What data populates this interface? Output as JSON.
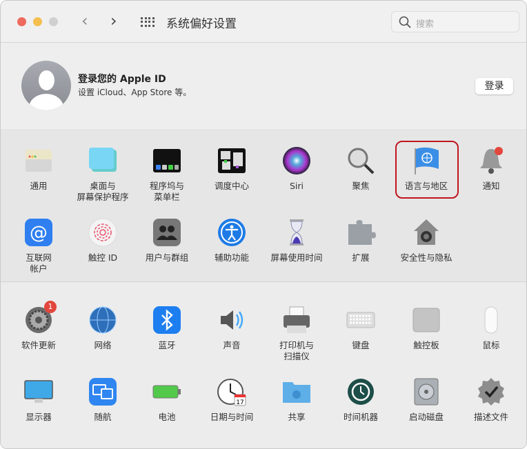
{
  "window": {
    "title": "系统偏好设置",
    "search_placeholder": "搜索"
  },
  "apple_id": {
    "title": "登录您的 Apple ID",
    "subtitle": "设置 iCloud、App Store 等。",
    "button": "登录"
  },
  "section1": [
    {
      "label": "通用",
      "icon": "general-icon"
    },
    {
      "label": "桌面与\n屏幕保护程序",
      "icon": "desktop-icon"
    },
    {
      "label": "程序坞与\n菜单栏",
      "icon": "dock-icon"
    },
    {
      "label": "调度中心",
      "icon": "mission-control-icon"
    },
    {
      "label": "Siri",
      "icon": "siri-icon"
    },
    {
      "label": "聚焦",
      "icon": "spotlight-icon"
    },
    {
      "label": "语言与地区",
      "icon": "language-flag-icon",
      "highlighted": true
    },
    {
      "label": "通知",
      "icon": "notification-bell-icon"
    },
    {
      "label": "互联网\n帐户",
      "icon": "internet-accounts-icon"
    },
    {
      "label": "触控 ID",
      "icon": "touch-id-icon"
    },
    {
      "label": "用户与群组",
      "icon": "users-groups-icon"
    },
    {
      "label": "辅助功能",
      "icon": "accessibility-icon"
    },
    {
      "label": "屏幕使用时间",
      "icon": "screen-time-icon"
    },
    {
      "label": "扩展",
      "icon": "extensions-icon"
    },
    {
      "label": "安全性与隐私",
      "icon": "security-icon"
    }
  ],
  "section2": [
    {
      "label": "软件更新",
      "icon": "software-update-icon",
      "badge": "1"
    },
    {
      "label": "网络",
      "icon": "network-icon"
    },
    {
      "label": "蓝牙",
      "icon": "bluetooth-icon"
    },
    {
      "label": "声音",
      "icon": "sound-icon"
    },
    {
      "label": "打印机与\n扫描仪",
      "icon": "printer-icon"
    },
    {
      "label": "键盘",
      "icon": "keyboard-icon"
    },
    {
      "label": "触控板",
      "icon": "trackpad-icon"
    },
    {
      "label": "鼠标",
      "icon": "mouse-icon"
    },
    {
      "label": "显示器",
      "icon": "display-icon"
    },
    {
      "label": "随航",
      "icon": "sidecar-icon"
    },
    {
      "label": "电池",
      "icon": "battery-icon"
    },
    {
      "label": "日期与时间",
      "icon": "date-time-icon",
      "calendar_day": "17"
    },
    {
      "label": "共享",
      "icon": "sharing-icon"
    },
    {
      "label": "时间机器",
      "icon": "time-machine-icon"
    },
    {
      "label": "启动磁盘",
      "icon": "startup-disk-icon"
    },
    {
      "label": "描述文件",
      "icon": "profiles-icon"
    }
  ],
  "colors": {
    "highlight": "#c0151d",
    "close": "#ed6a5e",
    "minimize": "#f5bf4f",
    "zoom": "#d0d0d0"
  }
}
